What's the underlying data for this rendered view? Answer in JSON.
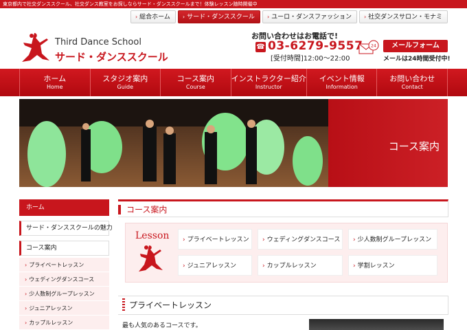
{
  "topbar": {
    "text": "東京都内で社交ダンススクール、社交ダンス教室をお探しならサード・ダンススクールまで！体験レッスン随時開催中"
  },
  "topnav": [
    {
      "label": "総合ホーム",
      "active": false
    },
    {
      "label": "サード・ダンススクール",
      "active": true
    },
    {
      "label": "ユーロ・ダンスファッション",
      "active": false
    },
    {
      "label": "社交ダンスサロン・モナミ",
      "active": false
    }
  ],
  "logo": {
    "en": "Third Dance School",
    "jp": "サード・ダンススクール"
  },
  "contact": {
    "label": "お問い合わせはお電話で!",
    "phone": "03-6279-9557",
    "hours": "[受付時間]12:00〜22:00",
    "mail_badge": "24",
    "mail_button": "メールフォーム",
    "mail_note": "メールは24時間受付中!"
  },
  "mainnav": [
    {
      "jp": "ホーム",
      "en": "Home"
    },
    {
      "jp": "スタジオ案内",
      "en": "Guide"
    },
    {
      "jp": "コース案内",
      "en": "Course"
    },
    {
      "jp": "インストラクター紹介",
      "en": "Instructor"
    },
    {
      "jp": "イベント情報",
      "en": "Information"
    },
    {
      "jp": "お問い合わせ",
      "en": "Contact"
    }
  ],
  "hero": {
    "title": "コース案内"
  },
  "sidebar": {
    "home": "ホーム",
    "items": [
      "サード・ダンススクールの魅力",
      "コース案内"
    ],
    "subitems": [
      "プライベートレッスン",
      "ウェディングダンスコース",
      "少人数制グループレッスン",
      "ジュニアレッスン",
      "カップルレッスン"
    ]
  },
  "content": {
    "section_title": "コース案内",
    "lesson_label": "Lesson",
    "lessons": [
      "プライベートレッスン",
      "ウェディングダンスコース",
      "少人数制グループレッスン",
      "ジュニアレッスン",
      "カップルレッスン",
      "学割レッスン"
    ],
    "private_title": "プライベートレッスン",
    "private_text": "最も人気のあるコースです。"
  },
  "colors": {
    "brand_red": "#c8161d",
    "pink_bg": "#fdeeee",
    "hero_green": "#7fe08a"
  }
}
